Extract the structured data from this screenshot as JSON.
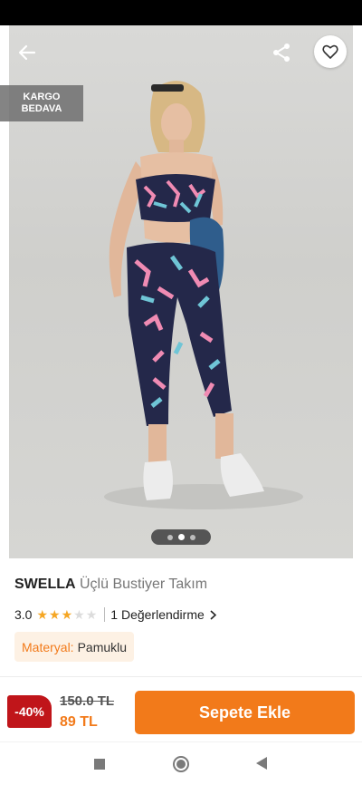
{
  "badge": {
    "free_shipping_line1": "KARGO",
    "free_shipping_line2": "BEDAVA"
  },
  "gallery": {
    "image_count": 3,
    "active_index": 1
  },
  "product": {
    "brand": "SWELLA",
    "name": "Üçlü Bustiyer Takım",
    "rating": "3.0",
    "stars_filled": 3,
    "stars_total": 5,
    "reviews_label": "1 Değerlendirme",
    "material_label": "Materyal:",
    "material_value": "Pamuklu"
  },
  "pricing": {
    "discount": "-40%",
    "old_price": "150.0 TL",
    "new_price": "89 TL"
  },
  "actions": {
    "add_to_cart": "Sepete Ekle"
  },
  "icons": {
    "back": "arrow-left-icon",
    "share": "share-icon",
    "favorite": "heart-icon",
    "review_chevron": "chevron-right-icon"
  },
  "colors": {
    "accent": "#f27a1a",
    "discount_red": "#c0151a",
    "star": "#f5a623"
  }
}
